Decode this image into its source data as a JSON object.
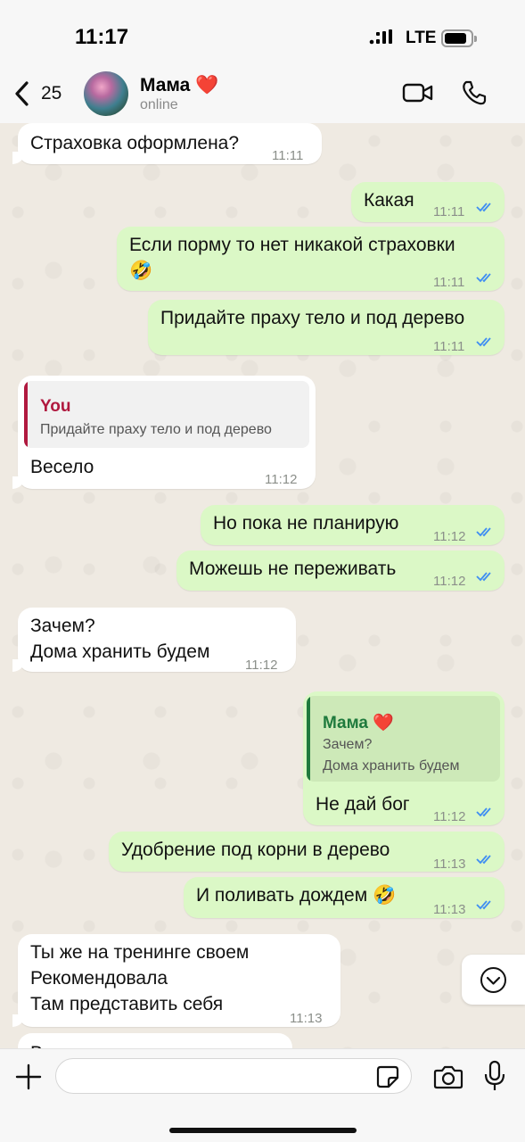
{
  "status_bar": {
    "time": "11:17",
    "network": "LTE"
  },
  "header": {
    "back_count": "25",
    "contact_name": "Мама ❤️",
    "contact_status": "online",
    "icons": [
      "chevron-left-icon",
      "video-call-icon",
      "phone-call-icon"
    ]
  },
  "messages": [
    {
      "dir": "in",
      "text": "Страховка оформлена?",
      "time": "11:11"
    },
    {
      "dir": "out",
      "text": "Какая",
      "time": "11:11",
      "read": true
    },
    {
      "dir": "out",
      "text": "Если порму то нет никакой страховки\n🤣",
      "time": "11:11",
      "read": true
    },
    {
      "dir": "out",
      "text": "Придайте праху тело и под дерево",
      "time": "11:11",
      "read": true
    },
    {
      "dir": "in",
      "reply_author": "You",
      "reply_text": "Придайте праху тело и под дерево",
      "text": "Весело",
      "time": "11:12"
    },
    {
      "dir": "out",
      "text": "Но пока не планирую",
      "time": "11:12",
      "read": true
    },
    {
      "dir": "out",
      "text": "Можешь не переживать",
      "time": "11:12",
      "read": true
    },
    {
      "dir": "in",
      "text": "Зачем?\nДома хранить будем",
      "time": "11:12"
    },
    {
      "dir": "out",
      "reply_author": "Мама ❤️",
      "reply_text": "Зачем?\nДома хранить будем",
      "text": "Не дай бог",
      "time": "11:12",
      "read": true
    },
    {
      "dir": "out",
      "text": "Удобрение под корни в дерево",
      "time": "11:13",
      "read": true
    },
    {
      "dir": "out",
      "text": "И поливать дождем 🤣",
      "time": "11:13",
      "read": true
    },
    {
      "dir": "in",
      "text": "Ты же на тренинге своем\nРекомендовала\nТам представить себя",
      "time": "11:13"
    },
    {
      "dir": "in",
      "text": "Вовремя отпустить",
      "time": ""
    }
  ],
  "colors": {
    "incoming_bubble": "#ffffff",
    "outgoing_bubble": "#dbf8c6",
    "read_ticks": "#3f8ef2",
    "reply_you_accent": "#b0193f",
    "reply_mama_accent": "#1f7a3d",
    "chat_background": "#efeae2"
  },
  "input": {
    "value": "",
    "placeholder": ""
  }
}
